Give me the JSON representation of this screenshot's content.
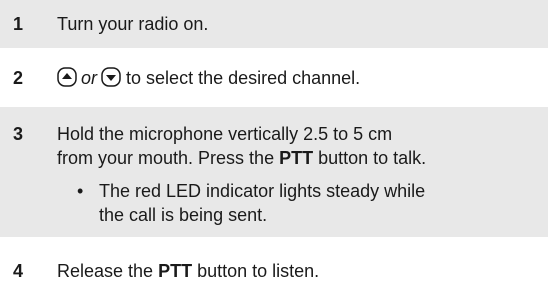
{
  "steps": [
    {
      "number": "1",
      "text": "Turn your radio on."
    },
    {
      "number": "2",
      "or_word": "or",
      "text_after": "to select the desired channel.",
      "icons": [
        "up-arrow-key-icon",
        "down-arrow-key-icon"
      ]
    },
    {
      "number": "3",
      "line1": "Hold the microphone vertically 2.5 to 5 cm",
      "line2_pre": "from your mouth. Press the ",
      "line2_bold": "PTT",
      "line2_post": " button to talk.",
      "bullet": "•",
      "bullet_line1": "The red LED indicator lights steady while",
      "bullet_line2": "the call is being sent."
    },
    {
      "number": "4",
      "pre": "Release the ",
      "bold": "PTT",
      "post": " button to listen."
    }
  ],
  "colors": {
    "shade": "#e8e8e8",
    "text": "#1a1a1a"
  }
}
